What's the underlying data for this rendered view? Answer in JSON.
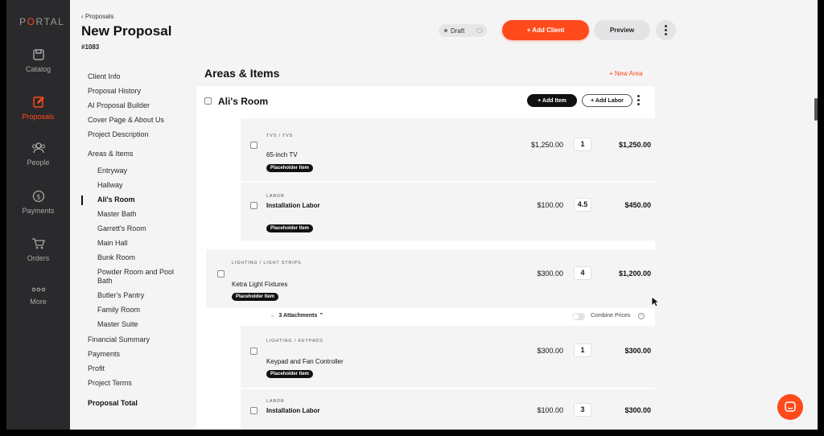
{
  "sidebar": {
    "logo": "PORTAL",
    "items": [
      {
        "label": "Catalog",
        "icon": "catalog-icon",
        "active": false
      },
      {
        "label": "Proposals",
        "icon": "proposals-icon",
        "active": true
      },
      {
        "label": "People",
        "icon": "people-icon",
        "active": false
      },
      {
        "label": "Payments",
        "icon": "payments-icon",
        "active": false
      },
      {
        "label": "Orders",
        "icon": "cart-icon",
        "active": false
      },
      {
        "label": "More",
        "icon": "more-dots-icon",
        "active": false
      }
    ]
  },
  "header": {
    "breadcrumb": "Proposals",
    "title": "New Proposal",
    "id": "#1083",
    "status": "Draft",
    "add_client": "+ Add Client",
    "preview": "Preview"
  },
  "toc": {
    "items": [
      "Client Info",
      "Proposal History",
      "AI Proposal Builder",
      "Cover Page & About Us",
      "Project Description",
      "Areas & Items"
    ],
    "areas": [
      "Entryway",
      "Hallway",
      "Ali's Room",
      "Master Bath",
      "Garrett's Room",
      "Main Hall",
      "Bunk Room",
      "Powder Room and Pool Bath",
      "Butler's Pantry",
      "Family Room",
      "Master Suite"
    ],
    "active_area": "Ali's Room",
    "summary": [
      "Financial Summary",
      "Payments",
      "Profit",
      "Project Terms"
    ],
    "total_label": "Proposal Total"
  },
  "areas": {
    "title": "Areas & Items",
    "new_area": "+ New Area",
    "room": {
      "name": "Ali's Room",
      "add_item": "+ Add Item",
      "add_labor": "+ Add Labor"
    },
    "items": [
      {
        "category": "TVS / TVS",
        "name": "65-inch TV",
        "tag": "Placeholder Item",
        "price": "$1,250.00",
        "qty": "1",
        "total": "$1,250.00"
      },
      {
        "category": "LABOR",
        "name": "Installation Labor",
        "tag": "Placeholder Item",
        "price": "$100.00",
        "qty": "4.5",
        "total": "$450.00"
      },
      {
        "category": "LIGHTING / LIGHT STRIPS",
        "name": "Ketra Light Fixtures",
        "tag": "Placeholder Item",
        "price": "$300.00",
        "qty": "4",
        "total": "$1,200.00"
      },
      {
        "category": "LIGHTING / KEYPADS",
        "name": "Keypad and Fan Controller",
        "tag": "Placeholder Item",
        "price": "$300.00",
        "qty": "1",
        "total": "$300.00"
      },
      {
        "category": "LABOR",
        "name": "Installation Labor",
        "tag": "",
        "price": "$100.00",
        "qty": "3",
        "total": "$300.00"
      }
    ],
    "attachments": "3 Attachments",
    "combine_prices": "Combine Prices"
  },
  "colors": {
    "accent": "#ff4a1c",
    "sidebar": "#2a2a2c"
  }
}
